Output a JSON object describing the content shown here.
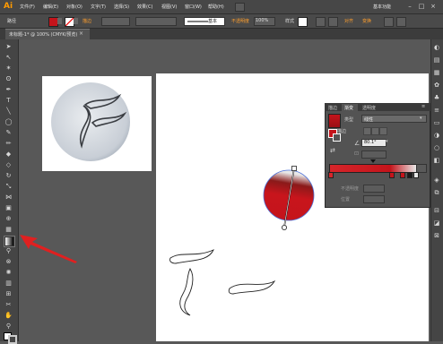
{
  "app": {
    "logo": "Ai",
    "workspace": "基本功能"
  },
  "menu": [
    "文件(F)",
    "编辑(E)",
    "对象(O)",
    "文字(T)",
    "选择(S)",
    "效果(C)",
    "视图(V)",
    "窗口(W)",
    "帮助(H)"
  ],
  "control_bar": {
    "path_label": "路径",
    "stroke_label": "描边",
    "stroke_style": "基本",
    "opacity_label": "不透明度",
    "opacity_value": "100%",
    "style_label": "样式",
    "align_label": "对齐",
    "transform_label": "变换"
  },
  "document_tab": {
    "label": "未标题-1* @ 100% (CMYK/预览)"
  },
  "gradient_panel": {
    "tabs": [
      "描边",
      "渐变",
      "透明度"
    ],
    "type_label": "类型",
    "type_value": "线性",
    "stroke_label": "描边",
    "angle_value": "80.1°",
    "opacity_label": "不透明度",
    "location_label": "位置"
  },
  "colors": {
    "accent_orange": "#ff9a00",
    "gradient_red": "#c4141b",
    "gradient_light": "#e8e8e8",
    "arrow_red": "#e02020"
  }
}
